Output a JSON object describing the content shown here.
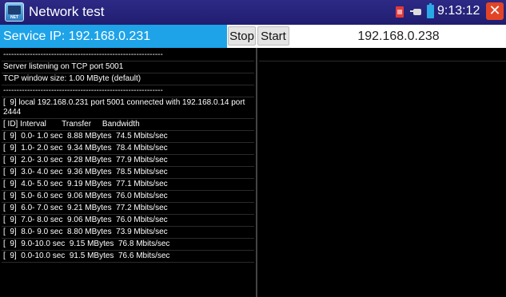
{
  "window": {
    "title": "Network test",
    "app_icon_text": "NET",
    "time": "9:13:12",
    "icons": [
      "app-icon",
      "sim-card-icon",
      "plug-icon",
      "battery-icon",
      "close-icon"
    ],
    "close_glyph": "✕"
  },
  "toolbar": {
    "service_ip_label": "Service IP: 192.168.0.231",
    "stop_label": "Stop",
    "start_label": "Start",
    "target_ip": "192.168.0.238"
  },
  "log": {
    "lines": [
      "------------------------------------------------------------",
      "Server listening on TCP port 5001",
      "TCP window size: 1.00 MByte (default)",
      "------------------------------------------------------------",
      "[  9] local 192.168.0.231 port 5001 connected with 192.168.0.14 port 2444",
      "[ ID] Interval       Transfer     Bandwidth",
      "[  9]  0.0- 1.0 sec  8.88 MBytes  74.5 Mbits/sec",
      "[  9]  1.0- 2.0 sec  9.34 MBytes  78.4 Mbits/sec",
      "[  9]  2.0- 3.0 sec  9.28 MBytes  77.9 Mbits/sec",
      "[  9]  3.0- 4.0 sec  9.36 MBytes  78.5 Mbits/sec",
      "[  9]  4.0- 5.0 sec  9.19 MBytes  77.1 Mbits/sec",
      "[  9]  5.0- 6.0 sec  9.06 MBytes  76.0 Mbits/sec",
      "[  9]  6.0- 7.0 sec  9.21 MBytes  77.2 Mbits/sec",
      "[  9]  7.0- 8.0 sec  9.06 MBytes  76.0 Mbits/sec",
      "[  9]  8.0- 9.0 sec  8.80 MBytes  73.9 Mbits/sec",
      "[  9]  9.0-10.0 sec  9.15 MBytes  76.8 Mbits/sec",
      "[  9]  0.0-10.0 sec  91.5 MBytes  76.6 Mbits/sec"
    ]
  },
  "colors": {
    "title_bar": "#201d70",
    "service_ip_bg": "#1ea3e8",
    "background": "#000000",
    "close_button": "#e34426"
  }
}
